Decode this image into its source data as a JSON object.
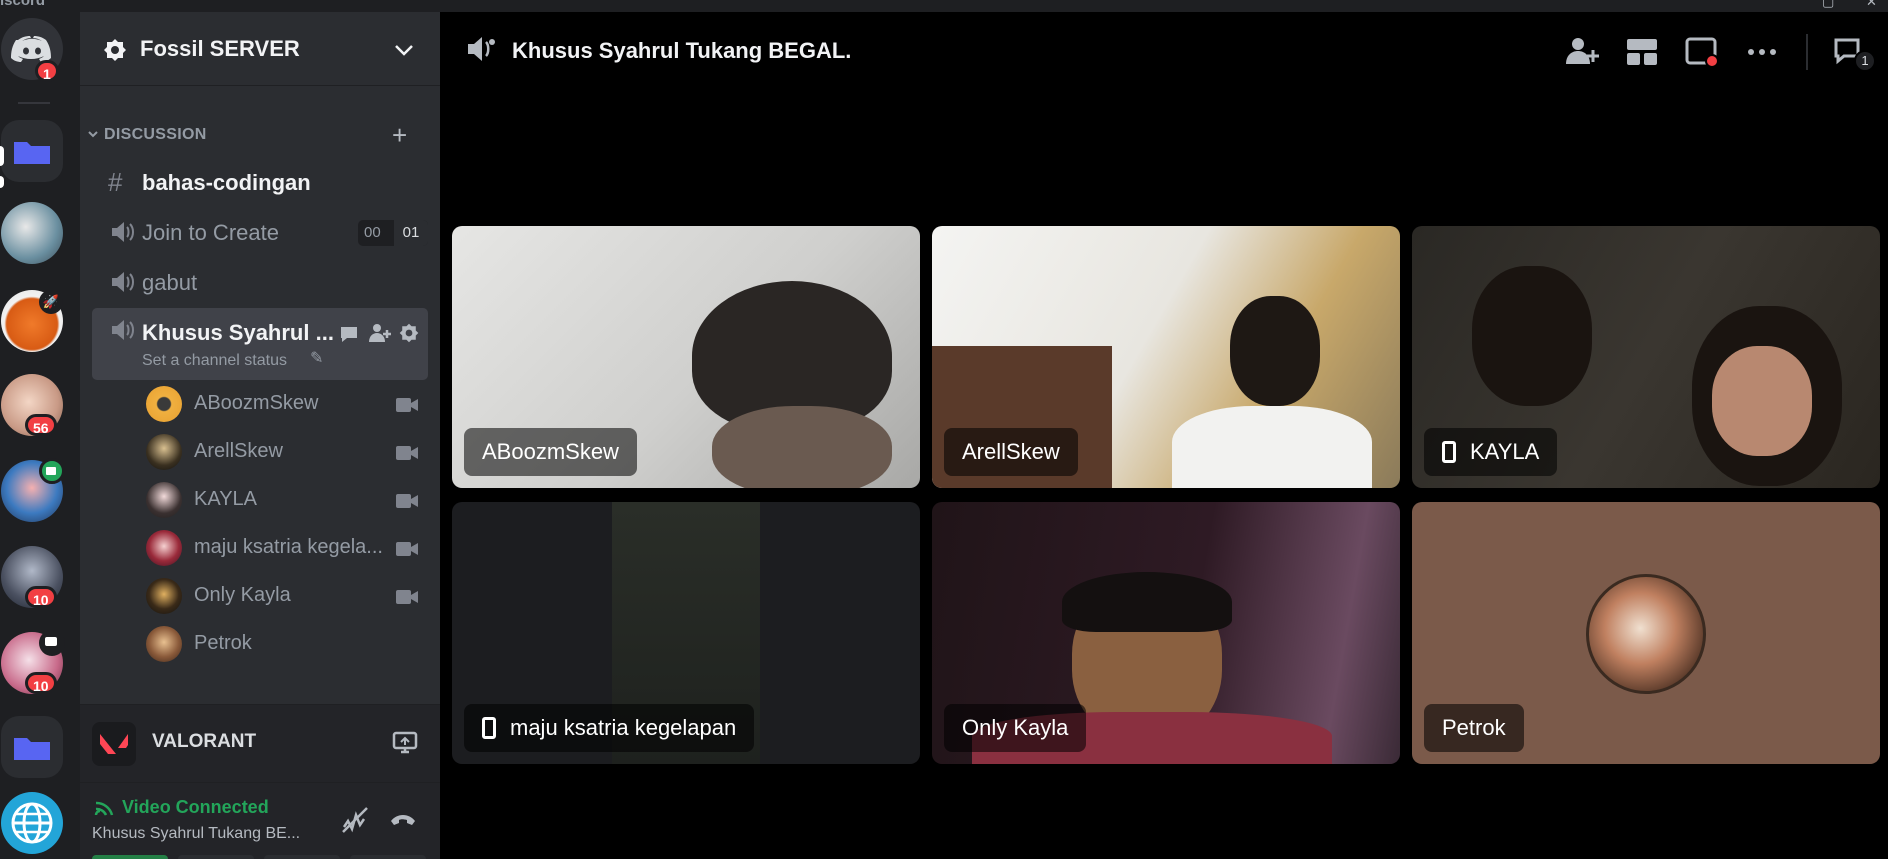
{
  "window": {
    "app_name": "iscord"
  },
  "rail": {
    "home_badge": "1",
    "badges": {
      "g5": "56",
      "g7": "10",
      "g8": "10"
    }
  },
  "server": {
    "name": "Fossil SERVER"
  },
  "category": {
    "name": "DISCUSSION"
  },
  "channels": [
    {
      "name": "bahas-codingan",
      "type": "text"
    },
    {
      "name": "Join to Create",
      "type": "voice",
      "count_left": "00",
      "count_right": "01"
    },
    {
      "name": "gabut",
      "type": "voice"
    },
    {
      "name": "Khusus Syahrul ...",
      "type": "voice",
      "status": "Set a channel status"
    }
  ],
  "voice_users": [
    {
      "name": "ABoozmSkew"
    },
    {
      "name": "ArellSkew"
    },
    {
      "name": "KAYLA"
    },
    {
      "name": "maju ksatria kegela..."
    },
    {
      "name": "Only Kayla"
    },
    {
      "name": "Petrok"
    }
  ],
  "activity": {
    "game": "VALORANT"
  },
  "voice_panel": {
    "status": "Video Connected",
    "channel": "Khusus Syahrul Tukang BE..."
  },
  "main": {
    "channel_title": "Khusus Syahrul Tukang BEGAL.",
    "inbox_badge": "1",
    "tiles": [
      {
        "name": "ABoozmSkew",
        "mobile": false
      },
      {
        "name": "ArellSkew",
        "mobile": false
      },
      {
        "name": "KAYLA",
        "mobile": true
      },
      {
        "name": "maju ksatria kegelapan",
        "mobile": true
      },
      {
        "name": "Only Kayla",
        "mobile": false
      },
      {
        "name": "Petrok",
        "mobile": false
      }
    ]
  },
  "colors": {
    "accent": "#5865f2",
    "danger": "#f23f43",
    "success": "#23a55a",
    "petrok_tile": "#7b5a4a"
  }
}
